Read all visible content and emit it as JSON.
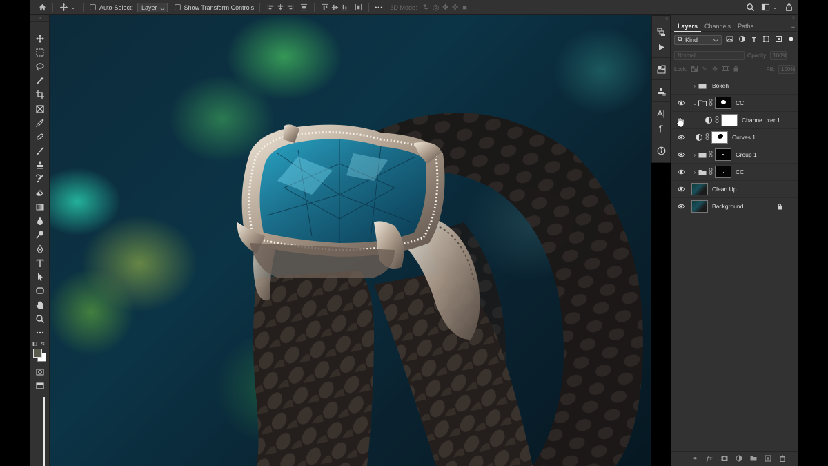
{
  "options_bar": {
    "auto_select_label": "Auto-Select:",
    "auto_select_target": "Layer",
    "transform_controls_label": "Show Transform Controls",
    "more_label": "•••",
    "mode_3d_label": "3D Mode:"
  },
  "layers_panel": {
    "tabs": [
      {
        "label": "Layers",
        "active": true
      },
      {
        "label": "Channels",
        "active": false
      },
      {
        "label": "Paths",
        "active": false
      }
    ],
    "filter_kind": "Kind",
    "blend_mode": "Normal",
    "opacity_label": "Opacity:",
    "opacity_value": "100%",
    "lock_label": "Lock:",
    "fill_label": "Fill:",
    "fill_value": "100%",
    "layers": [
      {
        "name": "Bokeh",
        "type": "group",
        "visible": false,
        "expanded": false,
        "indent": 0
      },
      {
        "name": "CC",
        "type": "group",
        "visible": true,
        "expanded": true,
        "indent": 0
      },
      {
        "name": "Channe...xer 1",
        "type": "adjustment",
        "visible": false,
        "indent": 1
      },
      {
        "name": "Curves 1",
        "type": "adjustment",
        "visible": true,
        "indent": 1
      },
      {
        "name": "Group 1",
        "type": "group",
        "visible": true,
        "expanded": false,
        "indent": 0
      },
      {
        "name": "CC",
        "type": "group",
        "visible": true,
        "expanded": false,
        "indent": 0
      },
      {
        "name": "Clean Up",
        "type": "pixel",
        "visible": true,
        "indent": 0
      },
      {
        "name": "Background",
        "type": "pixel",
        "visible": true,
        "locked": true,
        "indent": 0
      }
    ]
  },
  "colors": {
    "ui_panel": "#323232",
    "foreground_swatch": "#5b5a4f",
    "background_swatch": "#ffffff",
    "gem": "#1e6f8c"
  }
}
